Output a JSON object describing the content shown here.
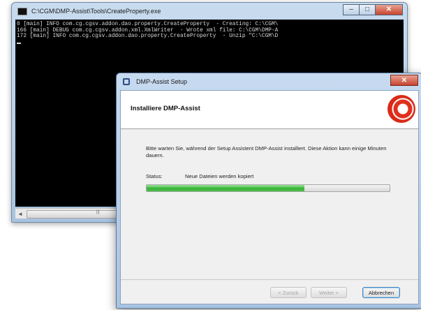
{
  "console": {
    "title": "C:\\CGM\\DMP-Assist\\Tools\\CreateProperty.exe",
    "lines": [
      "0 [main] INFO com.cg.cgsv.addon.dao.property.CreateProperty  - Creating: C:\\CGM\\",
      "166 [main] DEBUG com.cg.cgsv.addon.xml.XmlWriter  - Wrote xml file: C:\\CGM\\DMP-A",
      "172 [main] INFO com.cg.cgsv.addon.dao.property.CreateProperty  - Unzip \"C:\\CGM\\D"
    ],
    "minimize_glyph": "–",
    "maximize_glyph": "□",
    "close_glyph": "✕",
    "scroll_left_glyph": "◄",
    "scroll_right_glyph": "►",
    "scroll_grip": "|||"
  },
  "setup": {
    "title": "DMP-Assist Setup",
    "close_glyph": "✕",
    "banner_title": "Installiere DMP-Assist",
    "description": "Bitte warten Sie, während der Setup Assistent DMP-Assist installiert. Diese Aktion kann einige Minuten dauern.",
    "status_label": "Status:",
    "status_text": "Neue Dateien werden kopiert",
    "progress_percent": 65,
    "buttons": {
      "back": "< Zurück",
      "next": "Weiter >",
      "cancel": "Abbrechen"
    }
  },
  "colors": {
    "progress_green": "#37b237",
    "logo_red": "#e0301c"
  }
}
